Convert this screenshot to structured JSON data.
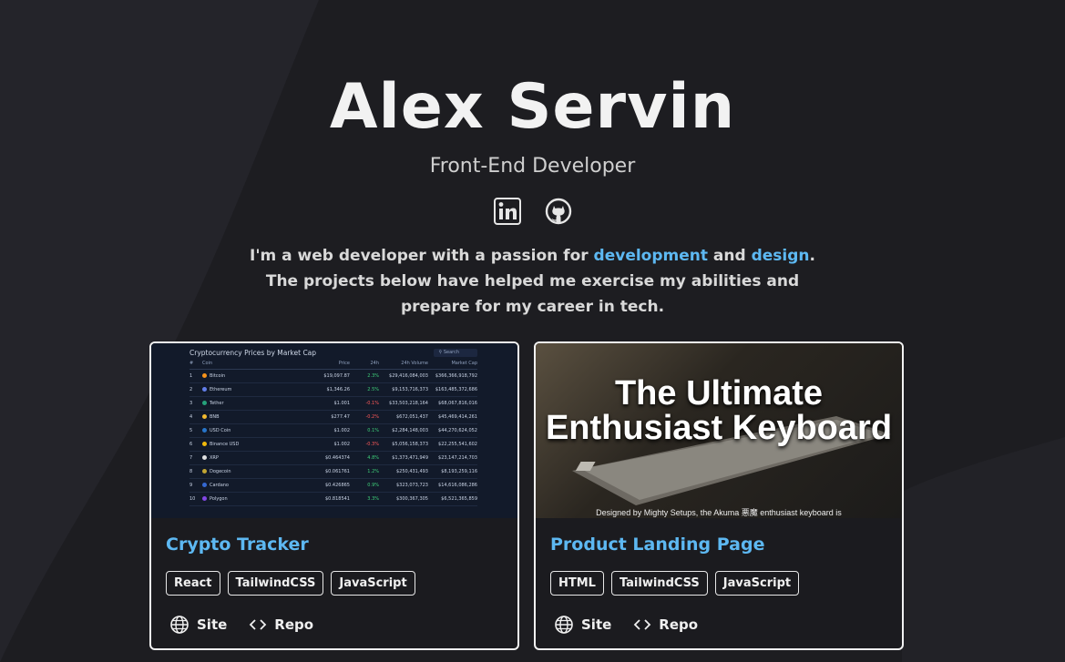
{
  "header": {
    "name": "Alex Servin",
    "role": "Front-End Developer"
  },
  "socials": [
    {
      "icon": "linkedin-icon"
    },
    {
      "icon": "github-icon"
    }
  ],
  "intro": {
    "part1": "I'm a web developer with a passion for ",
    "hl1": "development",
    "part2": " and ",
    "hl2": "design",
    "part3": ".",
    "line2": "The projects below have helped me exercise my abilities and",
    "line3": "prepare for my career in tech."
  },
  "colors": {
    "background": "#1d1d21",
    "accent": "#5db8f2",
    "card_border": "#f2f2f2"
  },
  "projects": [
    {
      "title": "Crypto Tracker",
      "tags": [
        "React",
        "TailwindCSS",
        "JavaScript"
      ],
      "site_label": "Site",
      "repo_label": "Repo",
      "thumb": {
        "table_title": "Cryptocurrency Prices by Market Cap",
        "search": "Search",
        "headers": [
          "#",
          "Coin",
          "Price",
          "24h",
          "24h Volume",
          "Market Cap"
        ],
        "rows": [
          [
            "1",
            "Bitcoin",
            "$19,097.87",
            "2.3%",
            "$29,416,084,003",
            "$366,366,918,792"
          ],
          [
            "2",
            "Ethereum",
            "$1,346.26",
            "2.5%",
            "$9,153,716,373",
            "$163,485,372,686"
          ],
          [
            "3",
            "Tether",
            "$1.001",
            "-0.1%",
            "$33,503,218,164",
            "$68,067,816,016"
          ],
          [
            "4",
            "BNB",
            "$277.47",
            "-0.2%",
            "$672,051,437",
            "$45,469,414,261"
          ],
          [
            "5",
            "USD Coin",
            "$1.002",
            "0.1%",
            "$2,284,148,003",
            "$44,270,624,052"
          ],
          [
            "6",
            "Binance USD",
            "$1.002",
            "-0.3%",
            "$5,056,158,373",
            "$22,255,541,602"
          ],
          [
            "7",
            "XRP",
            "$0.464374",
            "4.8%",
            "$1,373,471,949",
            "$23,147,214,703"
          ],
          [
            "8",
            "Dogecoin",
            "$0.061761",
            "1.2%",
            "$250,431,493",
            "$8,193,259,116"
          ],
          [
            "9",
            "Cardano",
            "$0.426865",
            "0.9%",
            "$323,073,723",
            "$14,616,086,286"
          ],
          [
            "10",
            "Polygon",
            "$0.818541",
            "3.3%",
            "$300,367,305",
            "$6,521,365,859"
          ]
        ]
      }
    },
    {
      "title": "Product Landing Page",
      "tags": [
        "HTML",
        "TailwindCSS",
        "JavaScript"
      ],
      "site_label": "Site",
      "repo_label": "Repo",
      "thumb": {
        "headline1": "The Ultimate",
        "headline2": "Enthusiast Keyboard",
        "caption": "Designed by Mighty Setups, the Akuma 悪魔 enthusiast keyboard is"
      }
    }
  ]
}
